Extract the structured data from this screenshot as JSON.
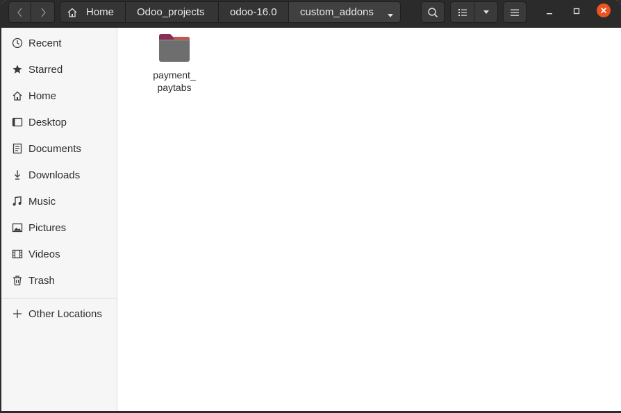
{
  "toolbar": {
    "back_icon": "chevron-left",
    "forward_icon": "chevron-right",
    "path": [
      {
        "label": "Home",
        "icon": "home-icon"
      },
      {
        "label": "Odoo_projects"
      },
      {
        "label": "odoo-16.0"
      },
      {
        "label": "custom_addons"
      }
    ],
    "search_icon": "search-icon",
    "view_icon": "list-view-icon",
    "view_options_icon": "dropdown-icon",
    "menu_icon": "hamburger-icon",
    "window_controls": [
      "minimize",
      "maximize",
      "close"
    ],
    "close_color": "#e95420"
  },
  "sidebar": {
    "items": [
      {
        "label": "Recent",
        "icon": "clock-icon"
      },
      {
        "label": "Starred",
        "icon": "star-icon"
      },
      {
        "label": "Home",
        "icon": "home-icon"
      },
      {
        "label": "Desktop",
        "icon": "desktop-icon"
      },
      {
        "label": "Documents",
        "icon": "document-icon"
      },
      {
        "label": "Downloads",
        "icon": "download-icon"
      },
      {
        "label": "Music",
        "icon": "music-icon"
      },
      {
        "label": "Pictures",
        "icon": "pictures-icon"
      },
      {
        "label": "Videos",
        "icon": "videos-icon"
      },
      {
        "label": "Trash",
        "icon": "trash-icon"
      }
    ],
    "other_locations": {
      "label": "Other Locations",
      "icon": "plus-icon"
    }
  },
  "content": {
    "items": [
      {
        "name": "payment_paytabs",
        "label_line1": "payment_",
        "label_line2": "paytabs",
        "type": "folder",
        "folder_color": "#6e6e6e",
        "folder_tab_color": "#8b2e56"
      }
    ]
  }
}
